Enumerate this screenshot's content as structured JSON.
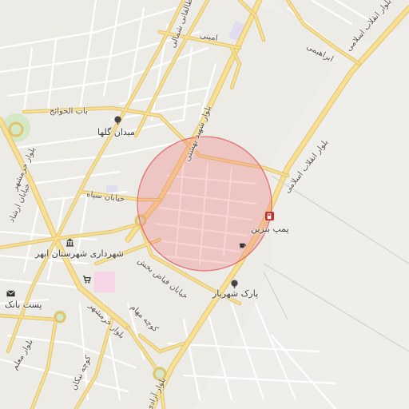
{
  "map": {
    "highlight_color": "#f08080",
    "labels": {
      "boulevard_enghelab": "بلوار انقلاب اسلامی",
      "boulevard_enghelab_2": "بلوار انقلاب اسلامی",
      "boulevard_shahid_beheshti": "بلوار شهید بهشتی",
      "taleghani_shomali": "طالقانی شمالی",
      "amini": "امینی",
      "ebrahimi": "ابراهیمی",
      "bab_al_havayej": "باب الحوائج",
      "meydan_gola": "میدان گلها",
      "boulevard_khorramshahr": "بلوار خرمشهر",
      "khiaban_ersad": "خیابان ارشاد",
      "khiaban_sepah": "خیابان سپاه",
      "shahrdari": "شهرداری شهرستان ابهر",
      "pomp_benzin": "پمپ بنزین",
      "post_bank": "پست بانک",
      "khiaban_fayyaz_bakhsh": "خیابان فیاض بخش",
      "park_shahriar": "پارک شهریار",
      "kooche_maham": "کوچه مهام",
      "boulevard_khorramshahr_2": "بلوار خرمشهر",
      "boulevard_moalem": "بلوار معلم",
      "kooche_nikan": "کوچه نیکان",
      "boulevard_azadi": "بلوار آزادی"
    },
    "icons": [
      "tree-icon",
      "library-icon",
      "cart-icon",
      "fuel-icon",
      "cafe-icon",
      "post-icon",
      "park-tree-icon"
    ]
  }
}
